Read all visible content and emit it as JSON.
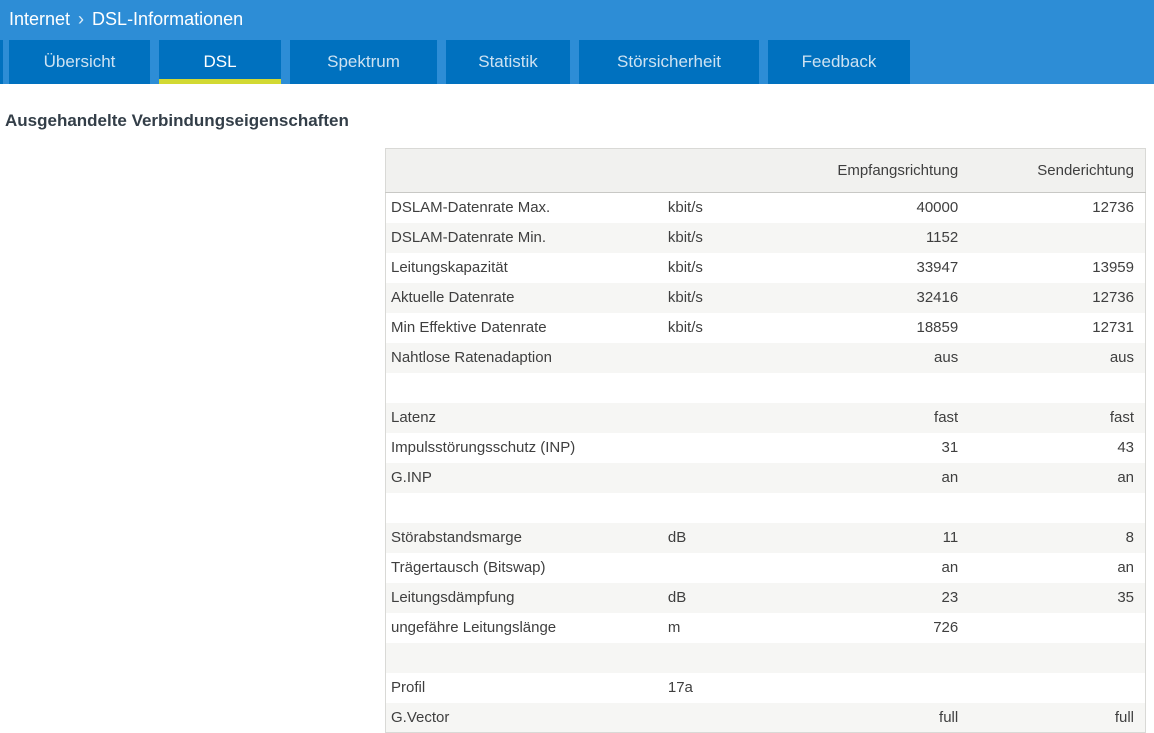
{
  "breadcrumb": {
    "section": "Internet",
    "separator": "›",
    "page": "DSL-Informationen"
  },
  "tabs": [
    {
      "label": "Übersicht",
      "active": false
    },
    {
      "label": "DSL",
      "active": true
    },
    {
      "label": "Spektrum",
      "active": false
    },
    {
      "label": "Statistik",
      "active": false
    },
    {
      "label": "Störsicherheit",
      "active": false
    },
    {
      "label": "Feedback",
      "active": false
    }
  ],
  "section_title": "Ausgehandelte Verbindungseigenschaften",
  "table": {
    "columns": [
      "",
      "",
      "Empfangsrichtung",
      "Senderichtung"
    ],
    "rows": [
      {
        "name": "DSLAM-Datenrate Max.",
        "unit": "kbit/s",
        "rx": "40000",
        "tx": "12736"
      },
      {
        "name": "DSLAM-Datenrate Min.",
        "unit": "kbit/s",
        "rx": "1152",
        "tx": ""
      },
      {
        "name": "Leitungskapazität",
        "unit": "kbit/s",
        "rx": "33947",
        "tx": "13959"
      },
      {
        "name": "Aktuelle Datenrate",
        "unit": "kbit/s",
        "rx": "32416",
        "tx": "12736"
      },
      {
        "name": "Min Effektive Datenrate",
        "unit": "kbit/s",
        "rx": "18859",
        "tx": "12731"
      },
      {
        "name": "Nahtlose Ratenadaption",
        "unit": "",
        "rx": "aus",
        "tx": "aus"
      },
      {
        "name": "",
        "unit": "",
        "rx": "",
        "tx": ""
      },
      {
        "name": "Latenz",
        "unit": "",
        "rx": "fast",
        "tx": "fast"
      },
      {
        "name": "Impulsstörungsschutz (INP)",
        "unit": "",
        "rx": "31",
        "tx": "43"
      },
      {
        "name": "G.INP",
        "unit": "",
        "rx": "an",
        "tx": "an"
      },
      {
        "name": "",
        "unit": "",
        "rx": "",
        "tx": ""
      },
      {
        "name": "Störabstandsmarge",
        "unit": "dB",
        "rx": "11",
        "tx": "8"
      },
      {
        "name": "Trägertausch (Bitswap)",
        "unit": "",
        "rx": "an",
        "tx": "an"
      },
      {
        "name": "Leitungsdämpfung",
        "unit": "dB",
        "rx": "23",
        "tx": "35"
      },
      {
        "name": "ungefähre Leitungslänge",
        "unit": "m",
        "rx": "726",
        "tx": ""
      },
      {
        "name": "",
        "unit": "",
        "rx": "",
        "tx": ""
      },
      {
        "name": "Profil",
        "unit": "17a",
        "rx": "",
        "tx": ""
      },
      {
        "name": "G.Vector",
        "unit": "",
        "rx": "full",
        "tx": "full"
      }
    ]
  },
  "colors": {
    "header_bg": "#2d8dd6",
    "tab_bg": "#0071bf",
    "active_tab_underline": "#d2d932",
    "active_tab_text": "#ffffff",
    "inactive_tab_text": "#cde2f2",
    "table_header_bg": "#f1f1ef",
    "zebra_row_bg": "#f6f6f4",
    "text_color": "#3f3f3f",
    "title_color": "#333e48"
  }
}
